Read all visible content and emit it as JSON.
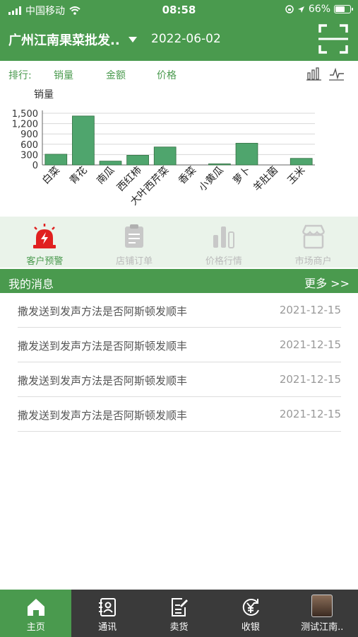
{
  "status_bar": {
    "carrier": "中国移动",
    "time": "08:58",
    "battery": "66%",
    "battery_level": 0.66
  },
  "header": {
    "market": "广州江南果菜批发..",
    "date": "2022-06-02",
    "scan_icon": "scan-icon"
  },
  "rank": {
    "label": "排行:",
    "tabs": [
      "销量",
      "金额",
      "价格"
    ],
    "chart_type_icons": [
      "bar-chart-icon",
      "line-chart-icon"
    ]
  },
  "chart_data": {
    "type": "bar",
    "ylabel": "销量",
    "categories": [
      "白菜",
      "青花",
      "南瓜",
      "西红柿",
      "大叶西芹菜",
      "香菜",
      "小黄瓜",
      "萝卜",
      "羊肚菌",
      "玉米"
    ],
    "values": [
      310,
      1420,
      110,
      280,
      520,
      0,
      25,
      630,
      0,
      190
    ],
    "yticks": [
      "1,500",
      "1,200",
      "900",
      "600",
      "300",
      "0"
    ],
    "ylim": [
      0,
      1500
    ],
    "bar_color": "#4fa56d"
  },
  "features": [
    {
      "label": "客户预警",
      "icon": "alarm-icon",
      "active": true
    },
    {
      "label": "店铺订单",
      "icon": "order-clipboard-icon",
      "active": false
    },
    {
      "label": "价格行情",
      "icon": "price-trend-icon",
      "active": false
    },
    {
      "label": "市场商户",
      "icon": "storefront-icon",
      "active": false
    }
  ],
  "messages": {
    "title": "我的消息",
    "more": "更多 >>",
    "items": [
      {
        "text": "撒发送到发声方法是否阿斯顿发顺丰",
        "date": "2021-12-15"
      },
      {
        "text": "撒发送到发声方法是否阿斯顿发顺丰",
        "date": "2021-12-15"
      },
      {
        "text": "撒发送到发声方法是否阿斯顿发顺丰",
        "date": "2021-12-15"
      },
      {
        "text": "撒发送到发声方法是否阿斯顿发顺丰",
        "date": "2021-12-15"
      }
    ]
  },
  "nav": [
    {
      "label": "主页",
      "icon": "home-icon",
      "active": true
    },
    {
      "label": "通讯",
      "icon": "contacts-icon",
      "active": false
    },
    {
      "label": "卖货",
      "icon": "sell-edit-icon",
      "active": false
    },
    {
      "label": "收银",
      "icon": "cashier-icon",
      "active": false
    },
    {
      "label": "测试江南..",
      "icon": "avatar",
      "active": false
    }
  ],
  "colors": {
    "primary": "#4a9a4e",
    "feature_bg": "#eaf3ea",
    "nav_bg": "#3a3a3a",
    "alarm": "#e02020"
  }
}
